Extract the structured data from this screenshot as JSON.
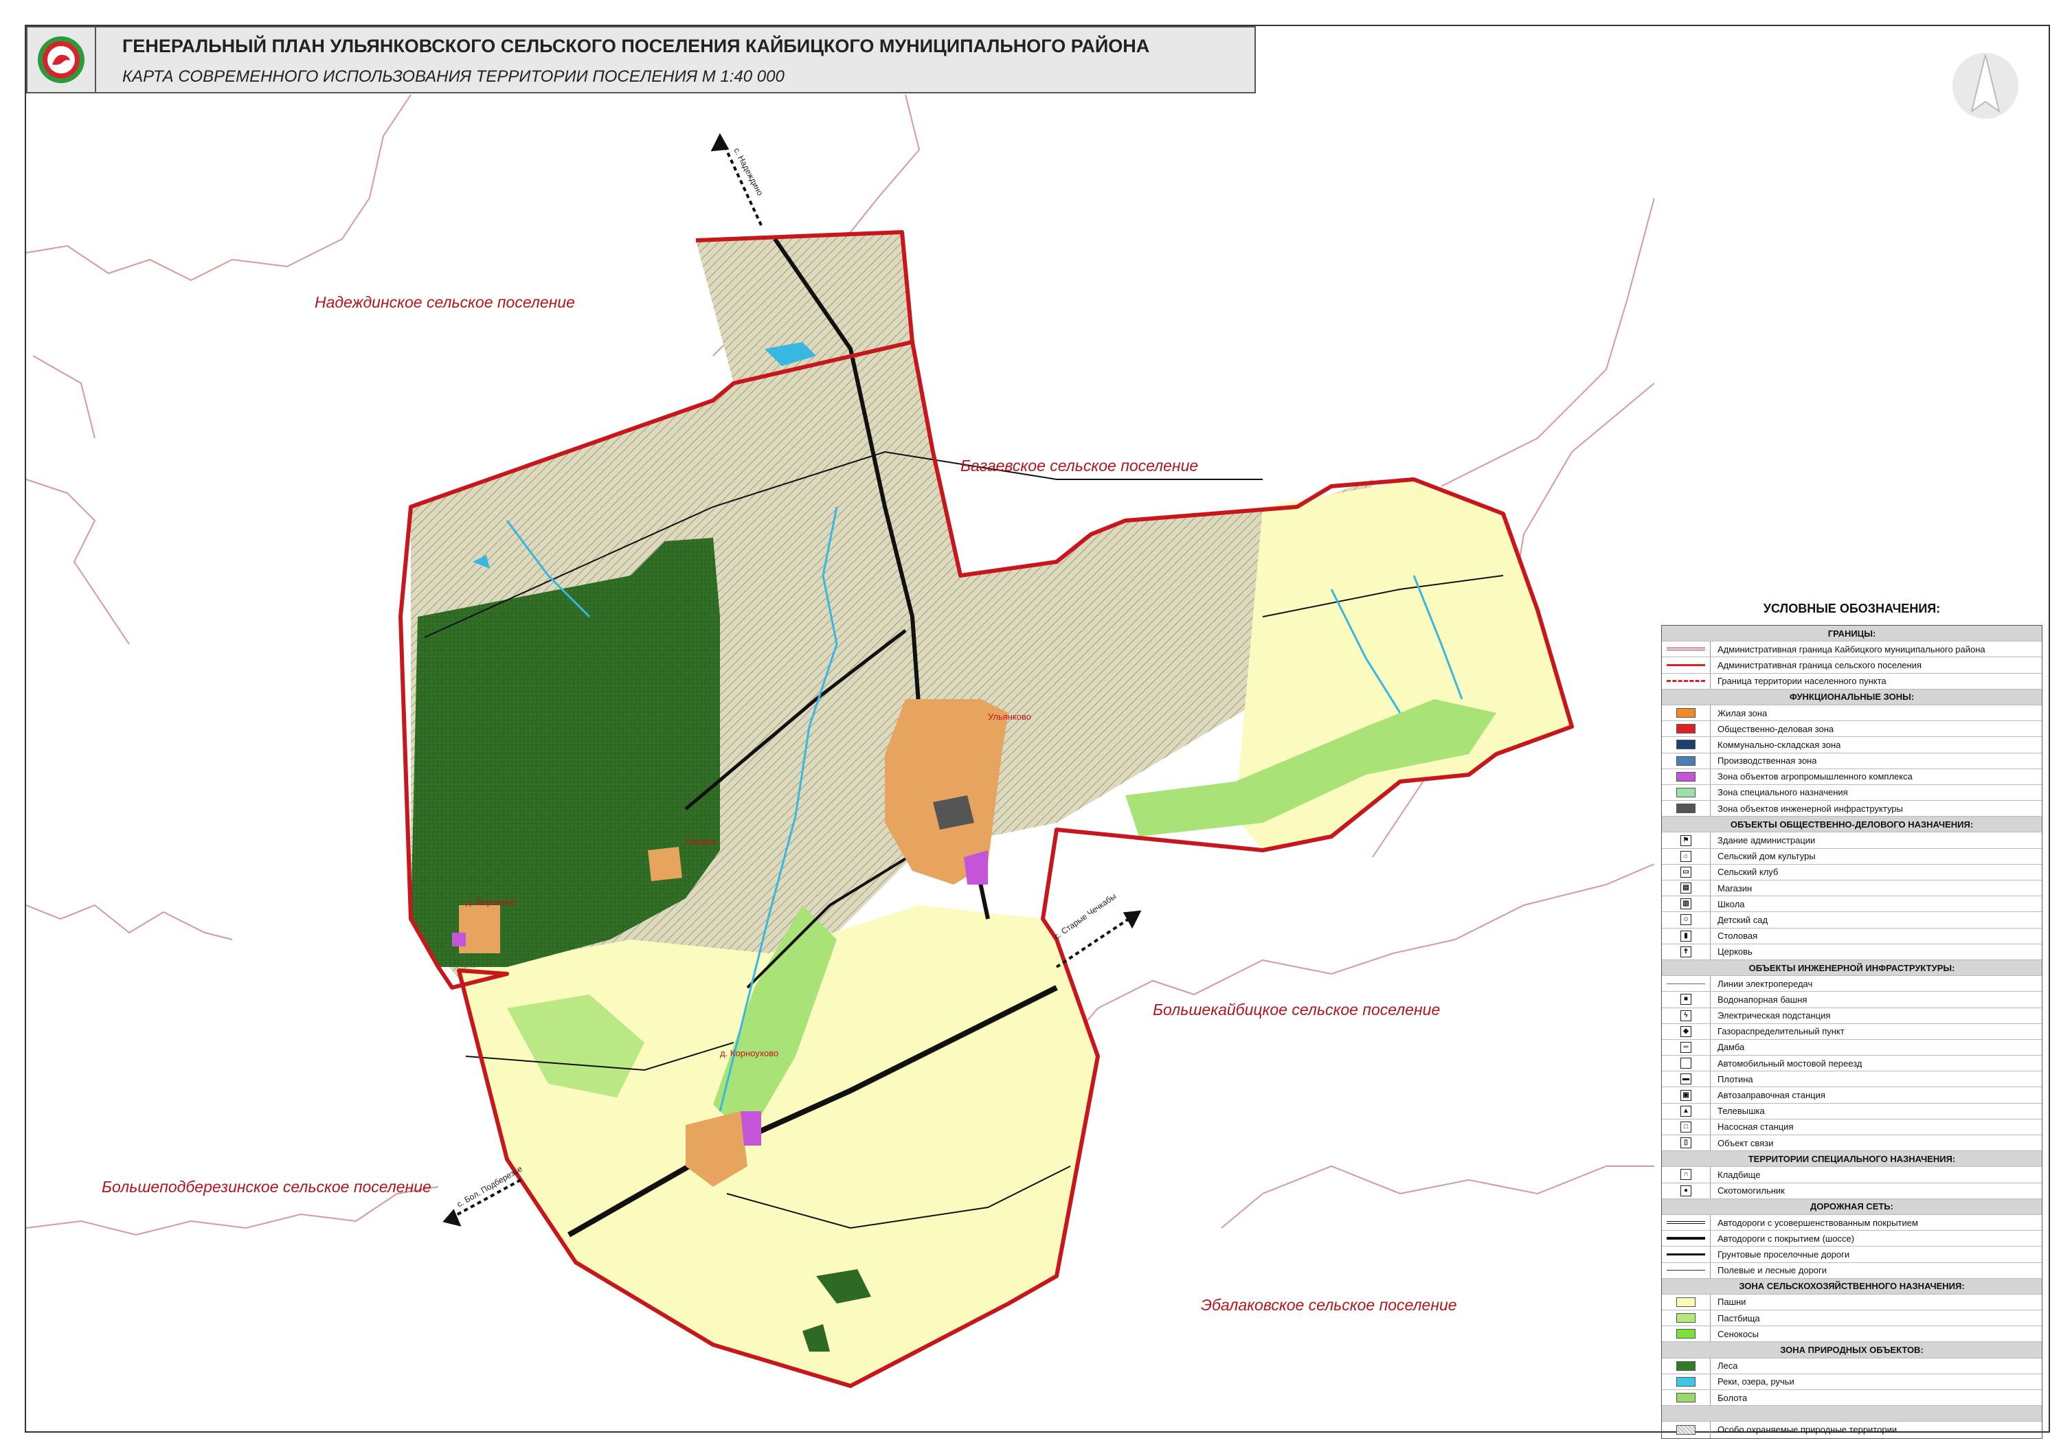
{
  "header": {
    "title": "ГЕНЕРАЛЬНЫЙ ПЛАН УЛЬЯНКОВСКОГО СЕЛЬСКОГО ПОСЕЛЕНИЯ КАЙБИЦКОГО МУНИЦИПАЛЬНОГО РАЙОНА",
    "subtitle": "КАРТА СОВРЕМЕННОГО ИСПОЛЬЗОВАНИЯ ТЕРРИТОРИИ ПОСЕЛЕНИЯ  М 1:40 000"
  },
  "map": {
    "neighbors": {
      "nadezhdinskoe": "Надеждинское сельское поселение",
      "bagaevskoe": "Багаевское сельское поселение",
      "bolshekaybitskoe": "Большекайбицкое сельское поселение",
      "bolshepodberezinskoe": "Большеподберезинское сельское поселение",
      "ebalakovskoe": "Эбалаковское сельское поселение"
    },
    "towns": {
      "ulyankovo": "Ульянково",
      "kornoukhovo": "д. Корноухово",
      "town_west": "д. Воронино",
      "town_mid": "Первое"
    },
    "directions": {
      "north": "с. Надеждино",
      "east": "с. Старые Чечкабы",
      "southwest": "с. Бол. Подберезье"
    }
  },
  "legend": {
    "title": "УСЛОВНЫЕ ОБОЗНАЧЕНИЯ:",
    "groups": [
      {
        "header": "ГРАНИЦЫ:",
        "items": [
          {
            "label": "Административная граница Кайбицкого муниципального района",
            "kind": "line",
            "color": "#d8232a",
            "style": "double"
          },
          {
            "label": "Административная граница сельского поселения",
            "kind": "line",
            "color": "#d8232a",
            "style": "solid"
          },
          {
            "label": "Граница территории населенного пункта",
            "kind": "line",
            "color": "#d8232a",
            "style": "dashdot"
          }
        ]
      },
      {
        "header": "ФУНКЦИОНАЛЬНЫЕ ЗОНЫ:",
        "items": [
          {
            "label": "Жилая зона",
            "kind": "swatch",
            "color": "#f08a2a"
          },
          {
            "label": "Общественно-деловая зона",
            "kind": "swatch",
            "color": "#e02020"
          },
          {
            "label": "Коммунально-складская зона",
            "kind": "swatch",
            "color": "#1f3f6e"
          },
          {
            "label": "Производственная зона",
            "kind": "swatch",
            "color": "#4a7eb5"
          },
          {
            "label": "Зона объектов агропромышленного комплекса",
            "kind": "swatch",
            "color": "#c455d8"
          },
          {
            "label": "Зона специального назначения",
            "kind": "swatch",
            "color": "#9fe0a6"
          },
          {
            "label": "Зона объектов инженерной инфраструктуры",
            "kind": "swatch",
            "color": "#555555"
          }
        ]
      },
      {
        "header": "ОБЪЕКТЫ ОБЩЕСТВЕННО-ДЕЛОВОГО НАЗНАЧЕНИЯ:",
        "items": [
          {
            "label": "Здание администрации",
            "kind": "icon",
            "glyph": "⚑"
          },
          {
            "label": "Сельский дом культуры",
            "kind": "icon",
            "glyph": "⌂"
          },
          {
            "label": "Сельский клуб",
            "kind": "icon",
            "glyph": "▭"
          },
          {
            "label": "Магазин",
            "kind": "icon",
            "glyph": "▤"
          },
          {
            "label": "Школа",
            "kind": "icon",
            "glyph": "▥"
          },
          {
            "label": "Детский сад",
            "kind": "icon",
            "glyph": "☺"
          },
          {
            "label": "Столовая",
            "kind": "icon",
            "glyph": "▮"
          },
          {
            "label": "Церковь",
            "kind": "icon",
            "glyph": "✝"
          }
        ]
      },
      {
        "header": "ОБЪЕКТЫ ИНЖЕНЕРНОЙ ИНФРАСТРУКТУРЫ:",
        "items": [
          {
            "label": "Линии электропередач",
            "kind": "line",
            "color": "#4a6fa8",
            "style": "thin"
          },
          {
            "label": "Водонапорная башня",
            "kind": "icon",
            "glyph": "■"
          },
          {
            "label": "Электрическая подстанция",
            "kind": "icon",
            "glyph": "ϟ"
          },
          {
            "label": "Газораспределительный пункт",
            "kind": "icon",
            "glyph": "◆"
          },
          {
            "label": "Дамба",
            "kind": "icon",
            "glyph": "═"
          },
          {
            "label": "Автомобильный мостовой переезд",
            "kind": "icon",
            "glyph": ""
          },
          {
            "label": "Плотина",
            "kind": "icon",
            "glyph": "▬"
          },
          {
            "label": "Автозаправочная станция",
            "kind": "icon",
            "glyph": "▣"
          },
          {
            "label": "Телевышка",
            "kind": "icon",
            "glyph": "▲"
          },
          {
            "label": "Насосная станция",
            "kind": "icon",
            "glyph": "□"
          },
          {
            "label": "Объект связи",
            "kind": "icon",
            "glyph": "▯"
          }
        ]
      },
      {
        "header": "ТЕРРИТОРИИ СПЕЦИАЛЬНОГО НАЗНАЧЕНИЯ:",
        "items": [
          {
            "label": "Кладбище",
            "kind": "icon",
            "glyph": "∩"
          },
          {
            "label": "Скотомогильник",
            "kind": "icon",
            "glyph": "●"
          }
        ]
      },
      {
        "header": "ДОРОЖНАЯ СЕТЬ:",
        "items": [
          {
            "label": "Автодороги с усовершенствованным покрытием",
            "kind": "line",
            "color": "#111111",
            "style": "double"
          },
          {
            "label": "Автодороги с покрытием (шоссе)",
            "kind": "line",
            "color": "#111111",
            "style": "thick"
          },
          {
            "label": "Грунтовые проселочные дороги",
            "kind": "line",
            "color": "#111111",
            "style": "solid"
          },
          {
            "label": "Полевые и лесные дороги",
            "kind": "line",
            "color": "#333333",
            "style": "thin"
          }
        ]
      },
      {
        "header": "ЗОНА СЕЛЬСКОХОЗЯЙСТВЕННОГО НАЗНАЧЕНИЯ:",
        "items": [
          {
            "label": "Пашни",
            "kind": "swatch",
            "color": "#fbfbb8"
          },
          {
            "label": "Пастбища",
            "kind": "swatch",
            "color": "#b3ea76"
          },
          {
            "label": "Сенокосы",
            "kind": "swatch",
            "color": "#7ee03a"
          }
        ]
      },
      {
        "header": "ЗОНА ПРИРОДНЫХ ОБЪЕКТОВ:",
        "items": [
          {
            "label": "Леса",
            "kind": "swatch",
            "color": "#2f7d23"
          },
          {
            "label": "Реки, озера, ручьи",
            "kind": "swatch",
            "color": "#3bc7e5"
          },
          {
            "label": "Болота",
            "kind": "swatch",
            "color": "#9ad86a"
          }
        ]
      },
      {
        "header": "",
        "items": [
          {
            "label": "Особо охраняемые природные территории",
            "kind": "hatch",
            "color": "#cccccc"
          }
        ]
      }
    ]
  },
  "colors": {
    "boundary_red": "#c8161d",
    "forest": "#2f6b24",
    "arable": "#fbfbbf",
    "hatched_area": "#d9d6b8",
    "pasture": "#a9e377",
    "water": "#38b8e0"
  }
}
